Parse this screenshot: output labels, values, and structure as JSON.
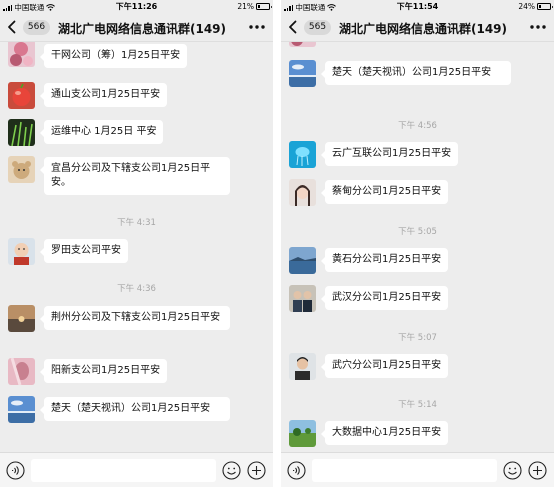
{
  "screens": [
    {
      "status": {
        "carrier": "中国联通",
        "time": "下午11:26",
        "battery": "21%",
        "battery_level": 0.21
      },
      "nav": {
        "back_count": "566",
        "title": "湖北广电网络信息通讯群(149)"
      },
      "timestamps": [
        "下午 4:31",
        "下午 4:36"
      ],
      "messages": [
        {
          "text": "干网公司（筹）1月25日平安",
          "avatar": "avatar-pink-flower"
        },
        {
          "text": "通山支公司1月25日平安",
          "avatar": "avatar-red-apple"
        },
        {
          "text": "运维中心 1月25日 平安",
          "avatar": "avatar-green-grass"
        },
        {
          "text": "宜昌分公司及下辖支公司1月25日平安。",
          "avatar": "avatar-teddy-bear"
        },
        {
          "text": "罗田支公司平安",
          "avatar": "avatar-baby-photo"
        },
        {
          "text": "荆州分公司及下辖支公司1月25日平安",
          "avatar": "avatar-sunset-sea"
        },
        {
          "text": "阳新支公司1月25日平安",
          "avatar": "avatar-pink-portrait"
        },
        {
          "text": "楚天（楚天视讯）公司1月25日平安",
          "avatar": "avatar-sky-landscape"
        }
      ]
    },
    {
      "status": {
        "carrier": "中国联通",
        "time": "下午11:54",
        "battery": "24%",
        "battery_level": 0.24
      },
      "nav": {
        "back_count": "565",
        "title": "湖北广电网络信息通讯群(149)"
      },
      "timestamps": [
        "下午 4:56",
        "下午 5:05",
        "下午 5:07",
        "下午 5:14"
      ],
      "messages": [
        {
          "text": "楚天（楚天视讯）公司1月25日平安",
          "avatar": "avatar-sky-landscape"
        },
        {
          "text": "云广互联公司1月25日平安",
          "avatar": "avatar-blue-jellyfish"
        },
        {
          "text": "蔡甸分公司1月25日平安",
          "avatar": "avatar-girl-photo"
        },
        {
          "text": "黄石分公司1月25日平安",
          "avatar": "avatar-blue-lake"
        },
        {
          "text": "武汉分公司1月25日平安",
          "avatar": "avatar-two-people"
        },
        {
          "text": "武穴分公司1月25日平安",
          "avatar": "avatar-man-portrait"
        },
        {
          "text": "大数据中心1月25日平安",
          "avatar": "avatar-green-field"
        }
      ]
    }
  ],
  "colors": {
    "chat_bg": "#ededed",
    "bubble": "#ffffff",
    "timestamp": "#a6a6a6"
  }
}
